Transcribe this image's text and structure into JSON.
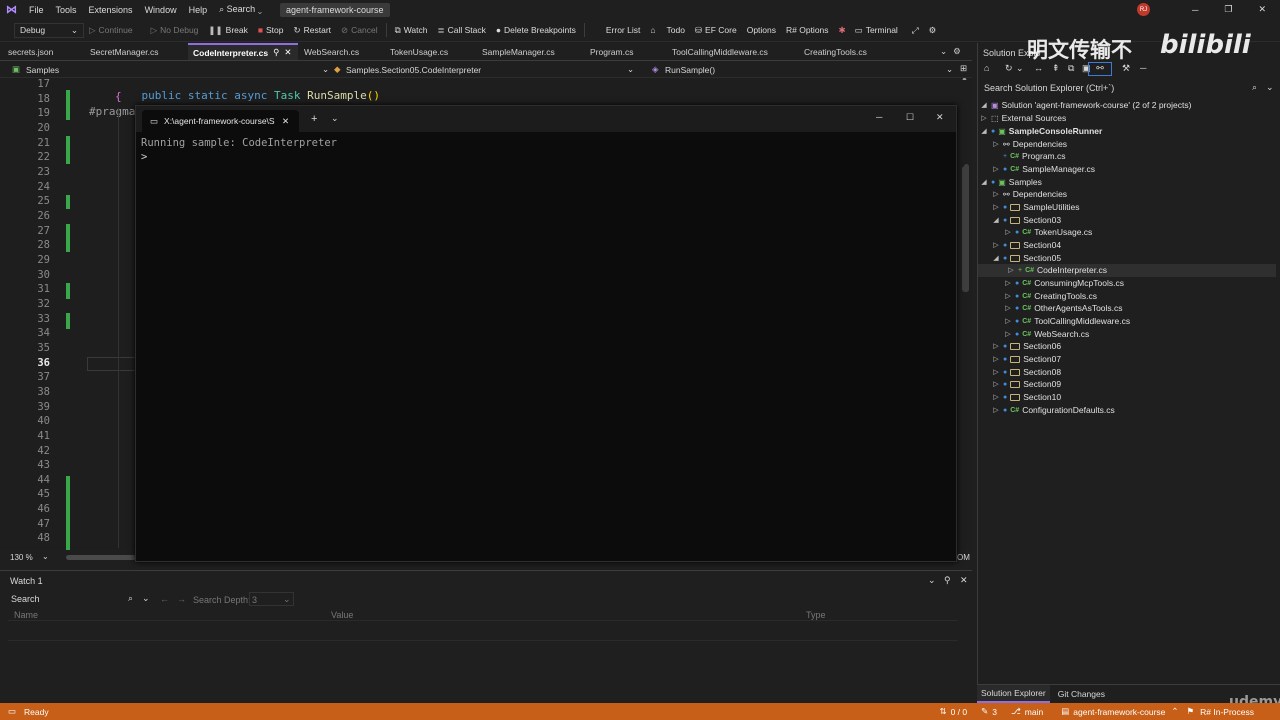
{
  "menu": {
    "items": [
      "File",
      "Tools",
      "Extensions",
      "Window",
      "Help"
    ],
    "search": "Search",
    "project": "agent-framework-course",
    "avatar": "RJ"
  },
  "toolbar": {
    "config": "Debug",
    "continue": "Continue",
    "no_debug": "No Debug",
    "break": "Break",
    "stop": "Stop",
    "restart": "Restart",
    "cancel": "Cancel",
    "watch": "Watch",
    "call_stack": "Call Stack",
    "delete_bp": "Delete Breakpoints",
    "error_list": "Error List",
    "todo": "Todo",
    "ef_core": "EF Core",
    "options": "Options",
    "r_options": "R# Options",
    "terminal": "Terminal"
  },
  "tabs": [
    "secrets.json",
    "SecretManager.cs",
    "CodeInterpreter.cs",
    "WebSearch.cs",
    "TokenUsage.cs",
    "SampleManager.cs",
    "Program.cs",
    "ToolCallingMiddleware.cs",
    "CreatingTools.cs"
  ],
  "nav": {
    "project": "Samples",
    "type": "Samples.Section05.CodeInterpreter",
    "member": "RunSample()"
  },
  "editor": {
    "lines": [
      "17",
      "18",
      "19",
      "20",
      "21",
      "22",
      "23",
      "24",
      "25",
      "26",
      "27",
      "28",
      "29",
      "30",
      "31",
      "32",
      "33",
      "34",
      "35",
      "36",
      "37",
      "38",
      "39",
      "40",
      "41",
      "42",
      "43",
      "44",
      "45",
      "46",
      "47",
      "48"
    ],
    "current_line": "36",
    "code_kw1": "public",
    "code_kw2": "static",
    "code_kw3": "async",
    "code_type": "Task",
    "code_method": "RunSample",
    "code_parens": "()",
    "code_brace": "{",
    "code_pragma": "#pragma",
    "zoom": "130 %",
    "trailing": "OM"
  },
  "terminal": {
    "tab_title": "X:\\agent-framework-course\\S",
    "line1": "Running sample: CodeInterpreter",
    "prompt": ">"
  },
  "watch": {
    "title": "Watch 1",
    "search_placeholder": "Search",
    "search_depth_label": "Search Depth:",
    "search_depth_value": "3",
    "col_name": "Name",
    "col_value": "Value",
    "col_type": "Type"
  },
  "solution_explorer": {
    "title": "Solution Explo",
    "search": "Search Solution Explorer (Ctrl+`)",
    "solution": "Solution 'agent-framework-course' (2 of 2 projects)",
    "external": "External Sources",
    "runner": "SampleConsoleRunner",
    "dependencies": "Dependencies",
    "program": "Program.cs",
    "sample_manager": "SampleManager.cs",
    "samples": "Samples",
    "sample_utilities": "SampleUtilities",
    "section03": "Section03",
    "token_usage": "TokenUsage.cs",
    "section04": "Section04",
    "section05": "Section05",
    "code_interpreter": "CodeInterpreter.cs",
    "consuming_mcp": "ConsumingMcpTools.cs",
    "creating_tools": "CreatingTools.cs",
    "other_agents": "OtherAgentsAsTools.cs",
    "tool_calling": "ToolCallingMiddleware.cs",
    "web_search": "WebSearch.cs",
    "section06": "Section06",
    "section07": "Section07",
    "section08": "Section08",
    "section09": "Section09",
    "section10": "Section10",
    "config_defaults": "ConfigurationDefaults.cs",
    "tab_se": "Solution Explorer",
    "tab_git": "Git Changes"
  },
  "status": {
    "ready": "Ready",
    "updown": "0 / 0",
    "pencil": "3",
    "branch": "main",
    "repo": "agent-framework-course",
    "rsharp": "R# In-Process"
  },
  "watermark": {
    "cn": "明文传输不",
    "bili": "bilibili",
    "udemy": "udemy"
  },
  "colors": {
    "accent": "#8f6fe0",
    "status_bar": "#c75f18",
    "change_marker": "#3aa84a",
    "keyword": "#569cd6",
    "type": "#4ec9b0",
    "method": "#dcdcaa"
  }
}
